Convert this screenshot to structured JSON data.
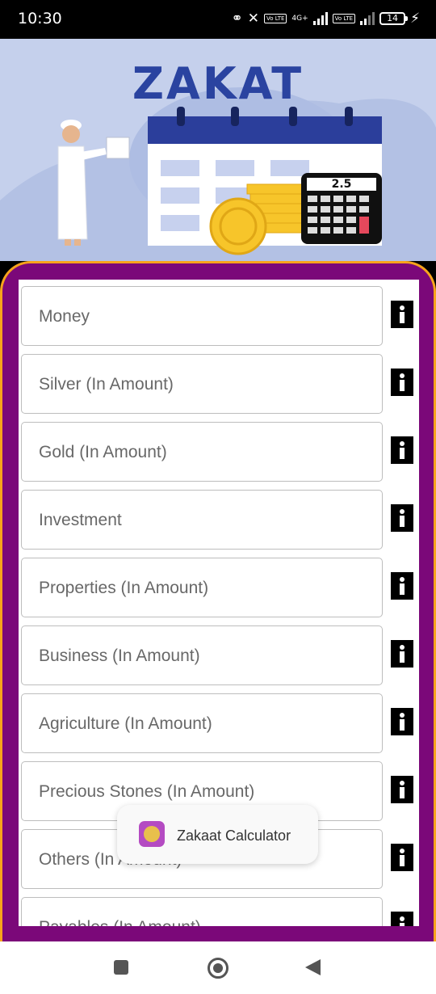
{
  "status_bar": {
    "time": "10:30",
    "icons": [
      "link-icon",
      "vibrate-off-icon",
      "volte-icon",
      "signal-4g-icon",
      "volte-icon",
      "signal-icon",
      "battery-charging-icon"
    ],
    "volte": "Vo LTE",
    "network": "4G+",
    "battery": "14"
  },
  "banner": {
    "title": "ZAKAT",
    "calculator_display": "2.5",
    "colors": {
      "background": "#c5d0ec",
      "title": "#2a43a0",
      "calendar_header": "#2b3e9b",
      "coins": "#f7c52a"
    }
  },
  "frame": {
    "colors": {
      "background": "#7b0879",
      "border": "#f7a41c"
    }
  },
  "fields": [
    {
      "label": "Money"
    },
    {
      "label": "Silver (In Amount)"
    },
    {
      "label": "Gold (In Amount)"
    },
    {
      "label": "Investment"
    },
    {
      "label": "Properties (In Amount)"
    },
    {
      "label": "Business (In Amount)"
    },
    {
      "label": "Agriculture (In Amount)"
    },
    {
      "label": "Precious Stones (In Amount)"
    },
    {
      "label": "Others (In Amount)"
    },
    {
      "label": "Payables (In Amount)"
    }
  ],
  "info_icon": "info-icon",
  "toast": {
    "app_name": "Zakaat Calculator",
    "icon": "app-icon"
  },
  "nav_bar": {
    "icons": [
      "recents-icon",
      "home-icon",
      "back-icon"
    ]
  }
}
